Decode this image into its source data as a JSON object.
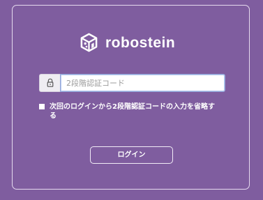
{
  "brand": {
    "name": "robostein",
    "logo_icon": "robostein-cube-logo-icon"
  },
  "two_factor": {
    "input_icon": "lock-icon",
    "placeholder": "2段階認証コード",
    "value": ""
  },
  "skip_option": {
    "label": "次回のログインから2段階認証コードの入力を省略する",
    "checked": false
  },
  "actions": {
    "login_label": "ログイン"
  },
  "colors": {
    "background": "#7f5d9f",
    "text": "#ffffff",
    "input_focus_border": "#94a7d8"
  }
}
